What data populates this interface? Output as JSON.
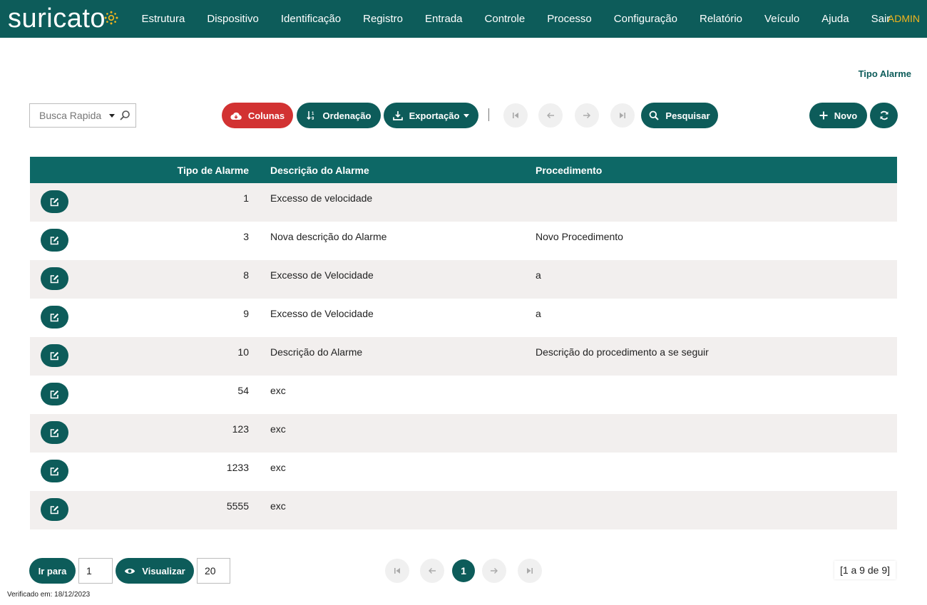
{
  "app": {
    "logo": "suricato",
    "user": "ADMIN"
  },
  "nav": [
    "Estrutura",
    "Dispositivo",
    "Identificação",
    "Registro",
    "Entrada",
    "Controle",
    "Processo",
    "Configuração",
    "Relatório",
    "Veículo",
    "Ajuda",
    "Sair"
  ],
  "page_title": "Tipo Alarme",
  "toolbar": {
    "search_placeholder": "Busca Rapida",
    "columns": "Colunas",
    "ordering": "Ordenação",
    "export": "Exportação",
    "search": "Pesquisar",
    "new": "Novo"
  },
  "colors": {
    "primary": "#0d5c5a",
    "danger": "#d23232",
    "accent": "#f2b51d"
  },
  "table": {
    "headers": [
      "Tipo de Alarme",
      "Descrição do Alarme",
      "Procedimento"
    ],
    "rows": [
      [
        "1",
        "Excesso de velocidade",
        ""
      ],
      [
        "3",
        "Nova descrição do Alarme",
        "Novo Procedimento"
      ],
      [
        "8",
        "Excesso de Velocidade",
        "a"
      ],
      [
        "9",
        "Excesso de Velocidade",
        "a"
      ],
      [
        "10",
        "Descrição do Alarme",
        "Descrição do procedimento a se seguir"
      ],
      [
        "54",
        "exc",
        ""
      ],
      [
        "123",
        "exc",
        ""
      ],
      [
        "1233",
        "exc",
        ""
      ],
      [
        "5555",
        "exc",
        ""
      ]
    ]
  },
  "footer": {
    "goto_label": "Ir para",
    "goto_value": "1",
    "view_label": "Visualizar",
    "view_value": "20",
    "current_page": "1",
    "range": "[1 a 9 de 9]",
    "verified": "Verificado em: 18/12/2023"
  }
}
